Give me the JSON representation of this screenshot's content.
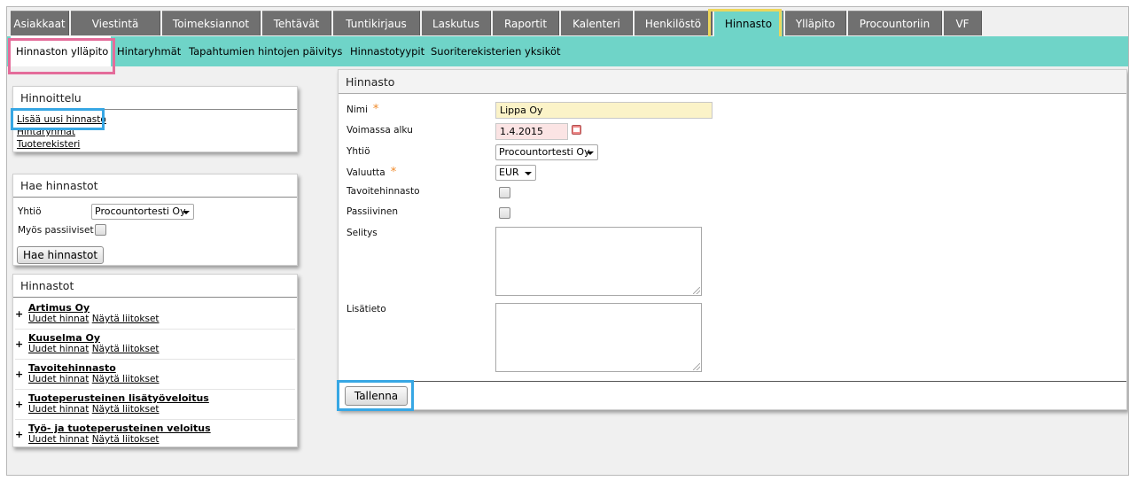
{
  "topnav": {
    "tabs": [
      "Asiakkaat",
      "Viestintä",
      "Toimeksiannot",
      "Tehtävät",
      "Tuntikirjaus",
      "Laskutus",
      "Raportit",
      "Kalenteri",
      "Henkilöstö",
      "Hinnasto",
      "Ylläpito",
      "Procountoriin",
      "VF"
    ],
    "active": "Hinnasto"
  },
  "subnav": {
    "items": [
      "Hinnaston ylläpito",
      "Hintaryhmät",
      "Tapahtumien hintojen päivitys",
      "Hinnastotyypit",
      "Suoriterekisterien yksiköt"
    ],
    "active": "Hinnaston ylläpito"
  },
  "hinnoittelu": {
    "title": "Hinnoittelu",
    "links": [
      "Lisää uusi hinnasto",
      "Hintaryhmät",
      "Tuoterekisteri"
    ]
  },
  "hae": {
    "title": "Hae hinnastot",
    "company_label": "Yhtiö",
    "company_value": "Procountortesti Oy",
    "passive_label": "Myös passiiviset",
    "button": "Hae hinnastot"
  },
  "hinnastot": {
    "title": "Hinnastot",
    "action_new": "Uudet hinnat",
    "action_links": "Näytä liitokset",
    "items": [
      "Artimus Oy",
      "Kuuselma Oy",
      "Tavoitehinnasto",
      "Tuoteperusteinen lisätyöveloitus",
      "Työ- ja tuoteperusteinen veloitus"
    ]
  },
  "form": {
    "title": "Hinnasto",
    "nimi_label": "Nimi",
    "nimi_value": "Lippa Oy",
    "voimassa_label": "Voimassa alku",
    "voimassa_value": "1.4.2015",
    "yhtio_label": "Yhtiö",
    "yhtio_value": "Procountortesti Oy",
    "valuutta_label": "Valuutta",
    "valuutta_value": "EUR",
    "tavoite_label": "Tavoitehinnasto",
    "passiivinen_label": "Passiivinen",
    "selitys_label": "Selitys",
    "lisatieto_label": "Lisätieto",
    "save_button": "Tallenna",
    "required_mark": "*"
  },
  "colors": {
    "tab_bg": "#707070",
    "accent": "#6fd4c8",
    "highlight_yellow": "#ecd65b",
    "highlight_pink": "#e46c9a",
    "highlight_blue": "#37a7e4",
    "input_yellow": "#fbf3c8",
    "input_pink": "#fbe4e4"
  },
  "icons": {
    "calendar": "calendar-icon"
  }
}
